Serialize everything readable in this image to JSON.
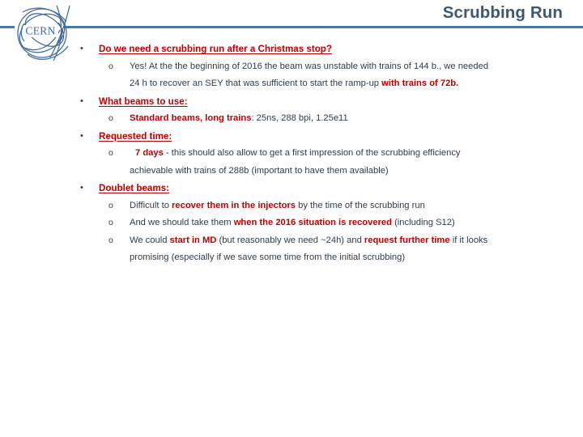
{
  "slide": {
    "title": "Scrubbing Run",
    "logo_text": "CERN",
    "colors": {
      "title": "#3f5872",
      "rule": "#4a76a8",
      "accent_red": "#C00000",
      "body_navy": "#2e3d4d",
      "logo_blue": "#41699e"
    },
    "bullet_glyph": "•",
    "sub_bullet_glyph": "o"
  },
  "blocks": [
    {
      "heading": "Do we need a scrubbing run after a Christmas stop?",
      "items": [
        {
          "line1_a": "Yes! At the the beginning of 2016 the beam was unstable with trains of 144 b., we needed",
          "line2_a": "24 h to recover an SEY that was sufficient to start the ramp-up ",
          "line2_b": "with trains of 72b."
        }
      ]
    },
    {
      "heading": "What beams to use:",
      "items": [
        {
          "lead": "Standard beams, long trains",
          "rest": ": 25ns, 288 bpi, 1.25e11"
        }
      ]
    },
    {
      "heading": "Requested time:",
      "items": [
        {
          "lead": "7 days",
          "rest": " - this should also allow to get a first impression of the scrubbing efficiency",
          "cont": "achievable with trains of 288b (important to have them available)"
        }
      ]
    },
    {
      "heading": "Doublet beams:",
      "items": [
        {
          "pre": "Difficult to ",
          "emph": "recover them in the injectors",
          "post": " by the time of the scrubbing run"
        },
        {
          "pre": "And we should take them ",
          "emph": "when the 2016 situation is recovered",
          "post": " (including S12)"
        },
        {
          "pre": "We could ",
          "emph": "start in MD",
          "mid": " (but reasonably we need ~24h) and ",
          "emph2": "request further time",
          "post": " if it looks",
          "cont": "promising (especially if we save some time from the initial scrubbing)"
        }
      ]
    }
  ]
}
